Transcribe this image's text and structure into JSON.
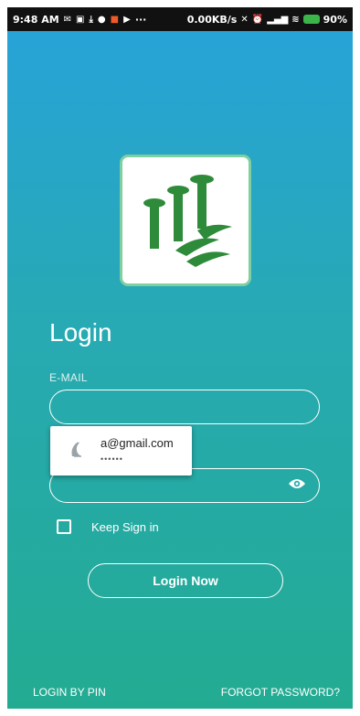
{
  "status_bar": {
    "time": "9:48 AM",
    "network_speed": "0.00KB/s",
    "battery": "90%",
    "more": "···"
  },
  "app": {
    "title": "Login",
    "email": {
      "label": "E-MAIL",
      "value": "",
      "placeholder": ""
    },
    "password": {
      "value": "",
      "placeholder": ""
    },
    "autofill": {
      "email": "a@gmail.com",
      "password_mask": "••••••"
    },
    "keep_signed_in": {
      "label": "Keep Sign in",
      "checked": false
    },
    "login_button": "Login Now",
    "links": {
      "login_by_pin": "LOGIN BY PIN",
      "forgot_password": "FORGOT PASSWORD?"
    },
    "colors": {
      "gradient_top": "#27a3d7",
      "gradient_bottom": "#23ab92",
      "logo_green": "#2e8b3a"
    }
  }
}
